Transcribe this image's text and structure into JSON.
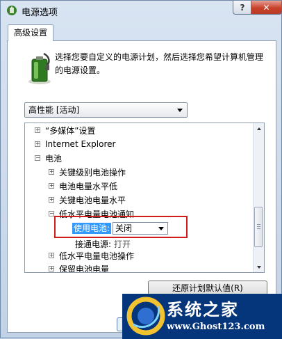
{
  "window": {
    "title": "电源选项",
    "help_label": "?",
    "close_label": "✕"
  },
  "tab": {
    "label": "高级设置"
  },
  "description": "选择您要自定义的电源计划，然后选择您希望计算机管理的电源设置。",
  "plan_select": {
    "value": "高性能 [活动]"
  },
  "tree": [
    {
      "label": "“多媒体”设置",
      "state": "collapsed"
    },
    {
      "label": "Internet Explorer",
      "state": "collapsed"
    },
    {
      "label": "电池",
      "state": "expanded"
    },
    {
      "label": "关键级别电池操作",
      "state": "collapsed"
    },
    {
      "label": "电池电量水平低",
      "state": "collapsed"
    },
    {
      "label": "关键电池电量水平",
      "state": "collapsed"
    },
    {
      "label": "低水平电量电池通知",
      "state": "expanded"
    },
    {
      "label": "低水平电量电池操作",
      "state": "collapsed"
    },
    {
      "label": "保留电池电量",
      "state": "collapsed"
    }
  ],
  "setting": {
    "battery_label": "使用电池:",
    "battery_value": "关闭",
    "plugged_label": "接通电源:",
    "plugged_value": "打开"
  },
  "restore_button": "还原计划默认值(R)",
  "watermark": {
    "brand": "系统之家",
    "url": "www.Ghost123.com"
  },
  "colors": {
    "annotation": "#d11a1a",
    "selection": "#3399ff",
    "watermark_bg": "#05357a"
  }
}
